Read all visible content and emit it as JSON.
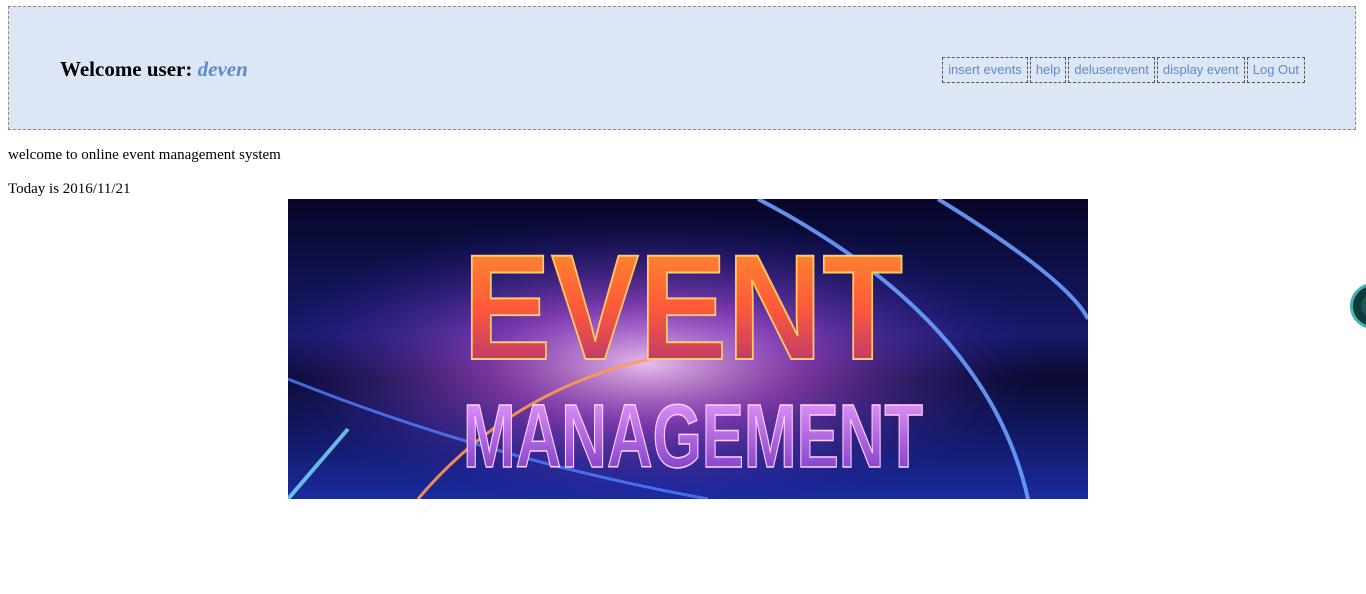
{
  "header": {
    "welcome_label": "Welcome user:",
    "username": "deven"
  },
  "nav": {
    "items": [
      {
        "label": "insert events"
      },
      {
        "label": "help"
      },
      {
        "label": "deluserevent"
      },
      {
        "label": "display event"
      },
      {
        "label": "Log Out"
      }
    ]
  },
  "main": {
    "intro": "welcome to online event management system",
    "today": "Today is 2016/11/21",
    "banner": {
      "line1": "EVENT",
      "line2": "MANAGEMENT"
    }
  },
  "colors": {
    "header_bg": "#dde6f5",
    "link": "#5e8acb"
  }
}
